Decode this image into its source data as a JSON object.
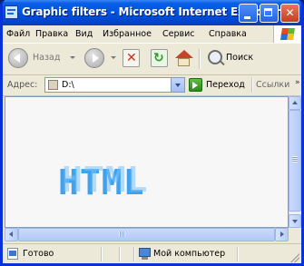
{
  "window": {
    "title": "Graphic filters - Microsoft Internet Explorer",
    "icon": "ie-page-icon",
    "controls": [
      "minimize",
      "maximize",
      "close"
    ]
  },
  "menu": {
    "items": [
      "Файл",
      "Правка",
      "Вид",
      "Избранное",
      "Сервис",
      "Справка"
    ],
    "logo": "windows-flag-icon"
  },
  "toolbar": {
    "back_label": "Назад",
    "search_label": "Поиск"
  },
  "address": {
    "label": "Адрес:",
    "value": "D:\\",
    "go_label": "Переход",
    "links_label": "Ссылки",
    "links_chevron": "»"
  },
  "content": {
    "art_text": "HTML",
    "art_color": "#3ea2ef"
  },
  "status": {
    "text": "Готово",
    "zone": "Мой компьютер"
  }
}
